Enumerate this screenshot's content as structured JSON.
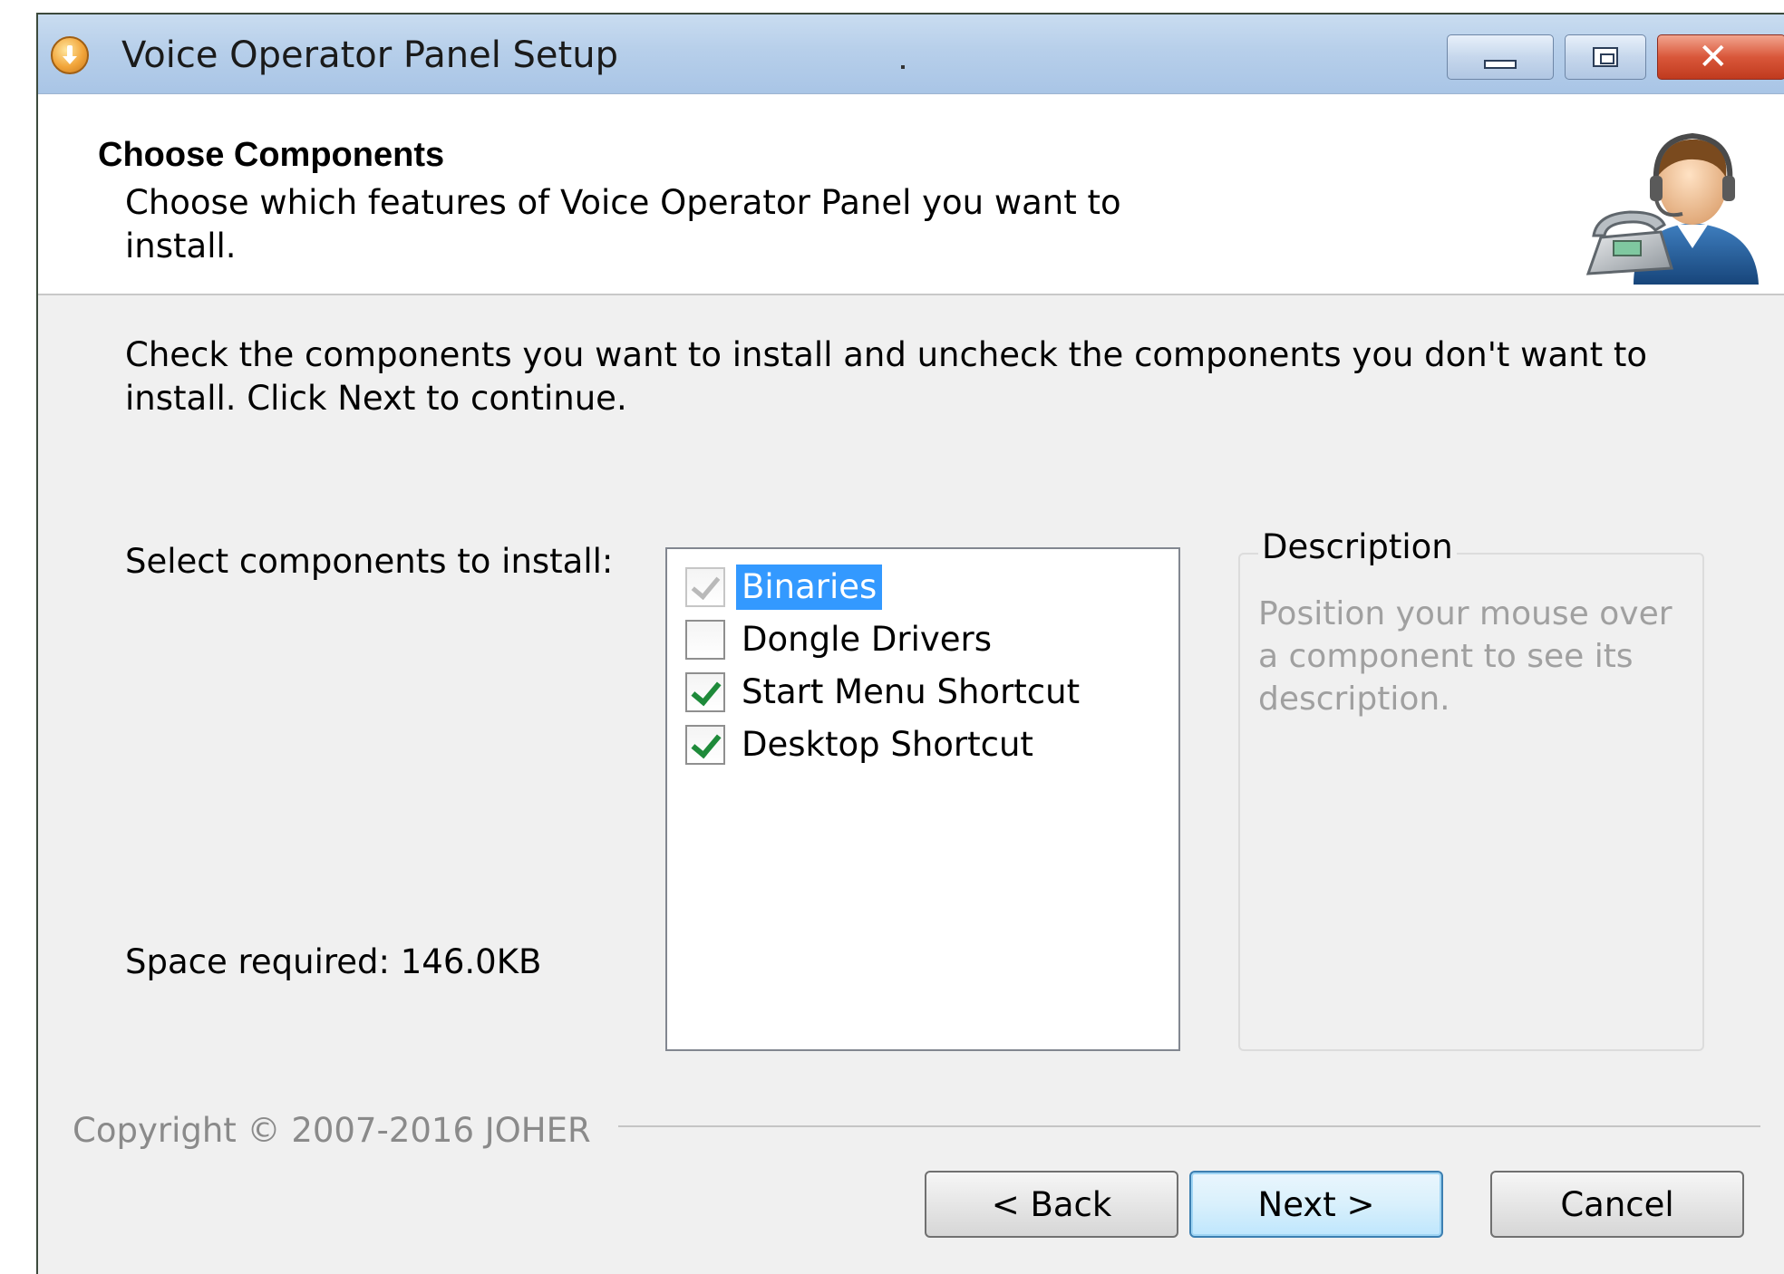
{
  "window": {
    "title": "Voice Operator Panel Setup",
    "title_mark": "·",
    "controls": {
      "close": "✕"
    }
  },
  "header": {
    "title": "Choose Components",
    "subtitle": "Choose which features of Voice Operator Panel you want to install."
  },
  "body": {
    "instructions": "Check the components you want to install and uncheck the components you don't want to install. Click Next to continue.",
    "select_label": "Select components to install:",
    "space_required": "Space required: 146.0KB"
  },
  "components": [
    {
      "label": "Binaries",
      "checked": true,
      "disabled": true,
      "selected": true
    },
    {
      "label": "Dongle Drivers",
      "checked": false,
      "disabled": false,
      "selected": false
    },
    {
      "label": "Start Menu Shortcut",
      "checked": true,
      "disabled": false,
      "selected": false
    },
    {
      "label": "Desktop Shortcut",
      "checked": true,
      "disabled": false,
      "selected": false
    }
  ],
  "description": {
    "legend": "Description",
    "text": "Position your mouse over a component to see its description."
  },
  "footer": {
    "copyright": "Copyright © 2007-2016 JOHER",
    "back_label": "< Back",
    "next_label": "Next >",
    "cancel_label": "Cancel"
  },
  "colors": {
    "selection": "#3399ff",
    "checkmark": "#1e8a3a",
    "titlebar": "#b7cfea",
    "close_button": "#c03a1e"
  },
  "icons": {
    "app": "installer-download-icon",
    "header": "operator-headset-phone-icon",
    "minimize": "minimize-icon",
    "maximize": "maximize-icon",
    "close": "close-icon"
  }
}
